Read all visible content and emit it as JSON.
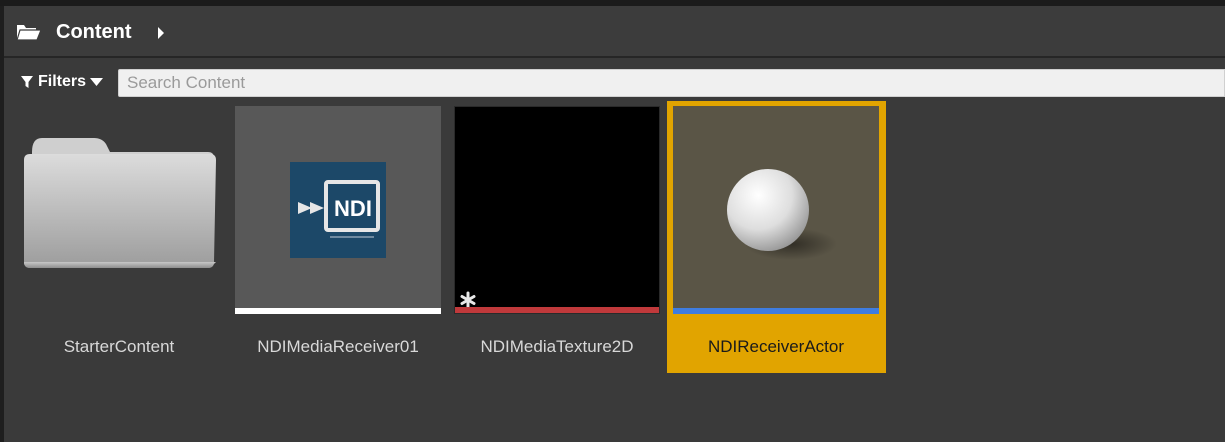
{
  "header": {
    "title": "Content",
    "icon": "folder-open-icon",
    "chevron": "chevron-right-icon"
  },
  "toolbar": {
    "filters_label": "Filters",
    "search_placeholder": "Search Content",
    "search_value": ""
  },
  "assets": [
    {
      "label": "StarterContent",
      "type": "folder"
    },
    {
      "label": "NDIMediaReceiver01",
      "type": "media-receiver",
      "thumb_icon": "NDI",
      "bar_color": "#ffffff"
    },
    {
      "label": "NDIMediaTexture2D",
      "type": "media-texture",
      "bar_color": "#c0393b"
    },
    {
      "label": "NDIReceiverActor",
      "type": "blueprint-actor",
      "bar_color": "#3f7de0",
      "selected": true
    }
  ],
  "colors": {
    "selection": "#e1a400",
    "background": "#3a3a3a"
  }
}
